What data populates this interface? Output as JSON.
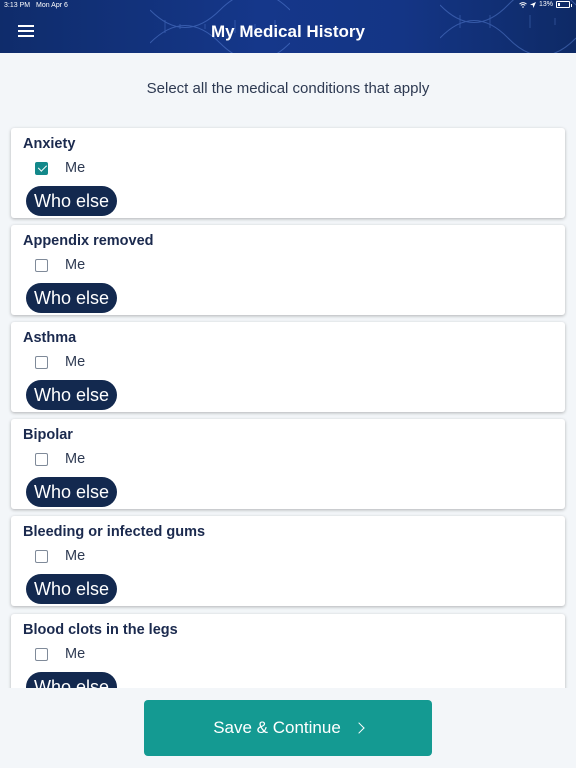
{
  "status_bar": {
    "time": "3:13 PM",
    "date": "Mon Apr 6",
    "battery": "13%"
  },
  "header": {
    "title": "My Medical History",
    "menu_icon": "hamburger-menu-icon"
  },
  "main": {
    "subtitle": "Select all the medical conditions that apply",
    "conditions": [
      {
        "name": "Anxiety",
        "me_label": "Me",
        "me_checked": true,
        "who_else_label": "Who else"
      },
      {
        "name": "Appendix removed",
        "me_label": "Me",
        "me_checked": false,
        "who_else_label": "Who else"
      },
      {
        "name": "Asthma",
        "me_label": "Me",
        "me_checked": false,
        "who_else_label": "Who else"
      },
      {
        "name": "Bipolar",
        "me_label": "Me",
        "me_checked": false,
        "who_else_label": "Who else"
      },
      {
        "name": "Bleeding or infected gums",
        "me_label": "Me",
        "me_checked": false,
        "who_else_label": "Who else"
      },
      {
        "name": "Blood clots in the legs",
        "me_label": "Me",
        "me_checked": false,
        "who_else_label": "Who else"
      }
    ]
  },
  "footer": {
    "save_label": "Save & Continue"
  },
  "colors": {
    "header": "#15378a",
    "accent": "#149a92",
    "pill": "#13294f",
    "background": "#f3f6f9"
  }
}
